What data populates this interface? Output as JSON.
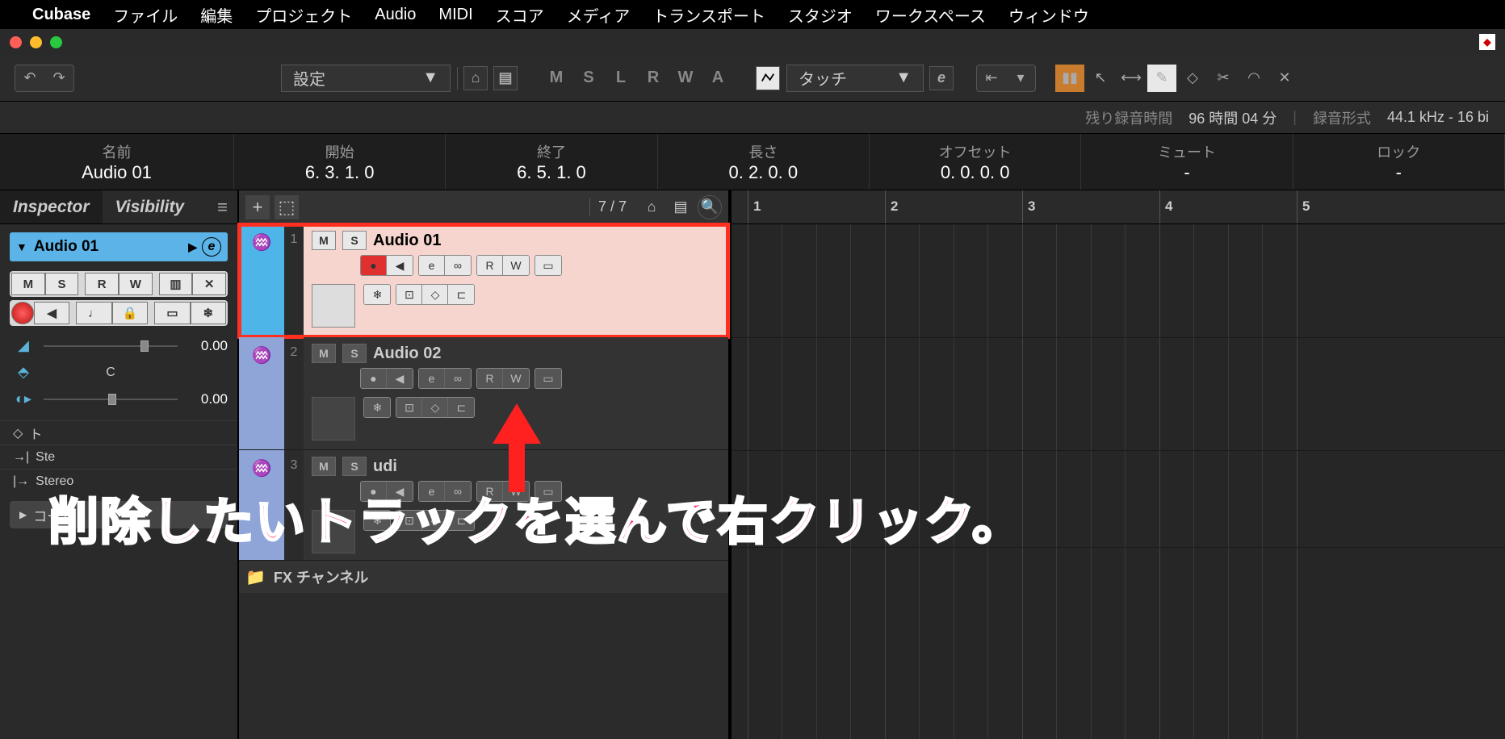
{
  "menubar": {
    "app": "Cubase",
    "items": [
      "ファイル",
      "編集",
      "プロジェクト",
      "Audio",
      "MIDI",
      "スコア",
      "メディア",
      "トランスポート",
      "スタジオ",
      "ワークスペース",
      "ウィンドウ"
    ]
  },
  "toolbar": {
    "config_dropdown": "設定",
    "automation_mode": "タッチ",
    "state_buttons": [
      "M",
      "S",
      "L",
      "R",
      "W",
      "A"
    ]
  },
  "status": {
    "rec_time_label": "残り録音時間",
    "rec_time_value": "96 時間 04 分",
    "format_label": "録音形式",
    "format_value": "44.1 kHz - 16 bi"
  },
  "infoline": {
    "cells": [
      {
        "label": "名前",
        "value": "Audio 01"
      },
      {
        "label": "開始",
        "value": "6. 3. 1.  0"
      },
      {
        "label": "終了",
        "value": "6. 5. 1.  0"
      },
      {
        "label": "長さ",
        "value": "0. 2. 0.  0"
      },
      {
        "label": "オフセット",
        "value": "0. 0. 0.  0"
      },
      {
        "label": "ミュート",
        "value": "-"
      },
      {
        "label": "ロック",
        "value": "-"
      }
    ]
  },
  "inspector": {
    "tabs": [
      "Inspector",
      "Visibility"
    ],
    "track_name": "Audio 01",
    "volume": "0.00",
    "pan_label": "C",
    "delay": "0.00",
    "routing": [
      "ト",
      "Ste",
      "Stereo"
    ],
    "chord_btn": "コード"
  },
  "tracklist": {
    "ratio": "7 / 7",
    "tracks": [
      {
        "num": "1",
        "name": "Audio 01",
        "selected": true,
        "rec": true
      },
      {
        "num": "2",
        "name": "Audio 02",
        "selected": false,
        "rec": false
      },
      {
        "num": "3",
        "name": "udi",
        "selected": false,
        "rec": false
      }
    ],
    "folder": "FX チャンネル"
  },
  "ruler": {
    "bars": [
      "1",
      "2",
      "3",
      "4",
      "5"
    ]
  },
  "annotation": "削除したいトラックを選んで右クリック。"
}
